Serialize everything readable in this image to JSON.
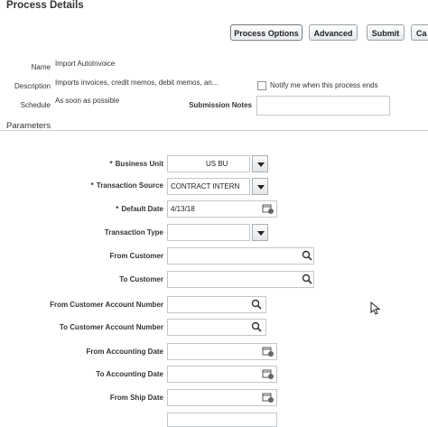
{
  "header": {
    "title": "Process Details"
  },
  "toolbar": {
    "process_options": "Process Options",
    "advanced": "Advanced",
    "submit": "Submit",
    "cancel": "Ca"
  },
  "details": {
    "name_label": "Name",
    "name_value": "Import AutoInvoice",
    "description_label": "Description",
    "description_value": "Imports invoices, credit memos, debit memos, an...",
    "schedule_label": "Schedule",
    "schedule_value": "As soon as possible",
    "notify_label": "Notify me when this process ends",
    "submission_notes_label": "Submission Notes",
    "submission_notes_value": ""
  },
  "parameters": {
    "section_title": "Parameters",
    "business_unit": {
      "label": "Business Unit",
      "value": "US BU"
    },
    "transaction_source": {
      "label": "Transaction Source",
      "value": "CONTRACT INTERN"
    },
    "default_date": {
      "label": "Default Date",
      "value": "4/13/18"
    },
    "transaction_type": {
      "label": "Transaction Type",
      "value": ""
    },
    "from_customer": {
      "label": "From Customer",
      "value": ""
    },
    "to_customer": {
      "label": "To Customer",
      "value": ""
    },
    "from_customer_account_number": {
      "label": "From Customer Account Number",
      "value": ""
    },
    "to_customer_account_number": {
      "label": "To Customer Account Number",
      "value": ""
    },
    "from_accounting_date": {
      "label": "From Accounting Date",
      "value": ""
    },
    "to_accounting_date": {
      "label": "To Accounting Date",
      "value": ""
    },
    "from_ship_date": {
      "label": "From Ship Date",
      "value": ""
    }
  },
  "required_marker": "*",
  "icons": {
    "search": "magnifier-icon",
    "calendar": "calendar-icon",
    "dropdown": "chevron-down-icon",
    "cursor": "mouse-pointer-icon"
  }
}
